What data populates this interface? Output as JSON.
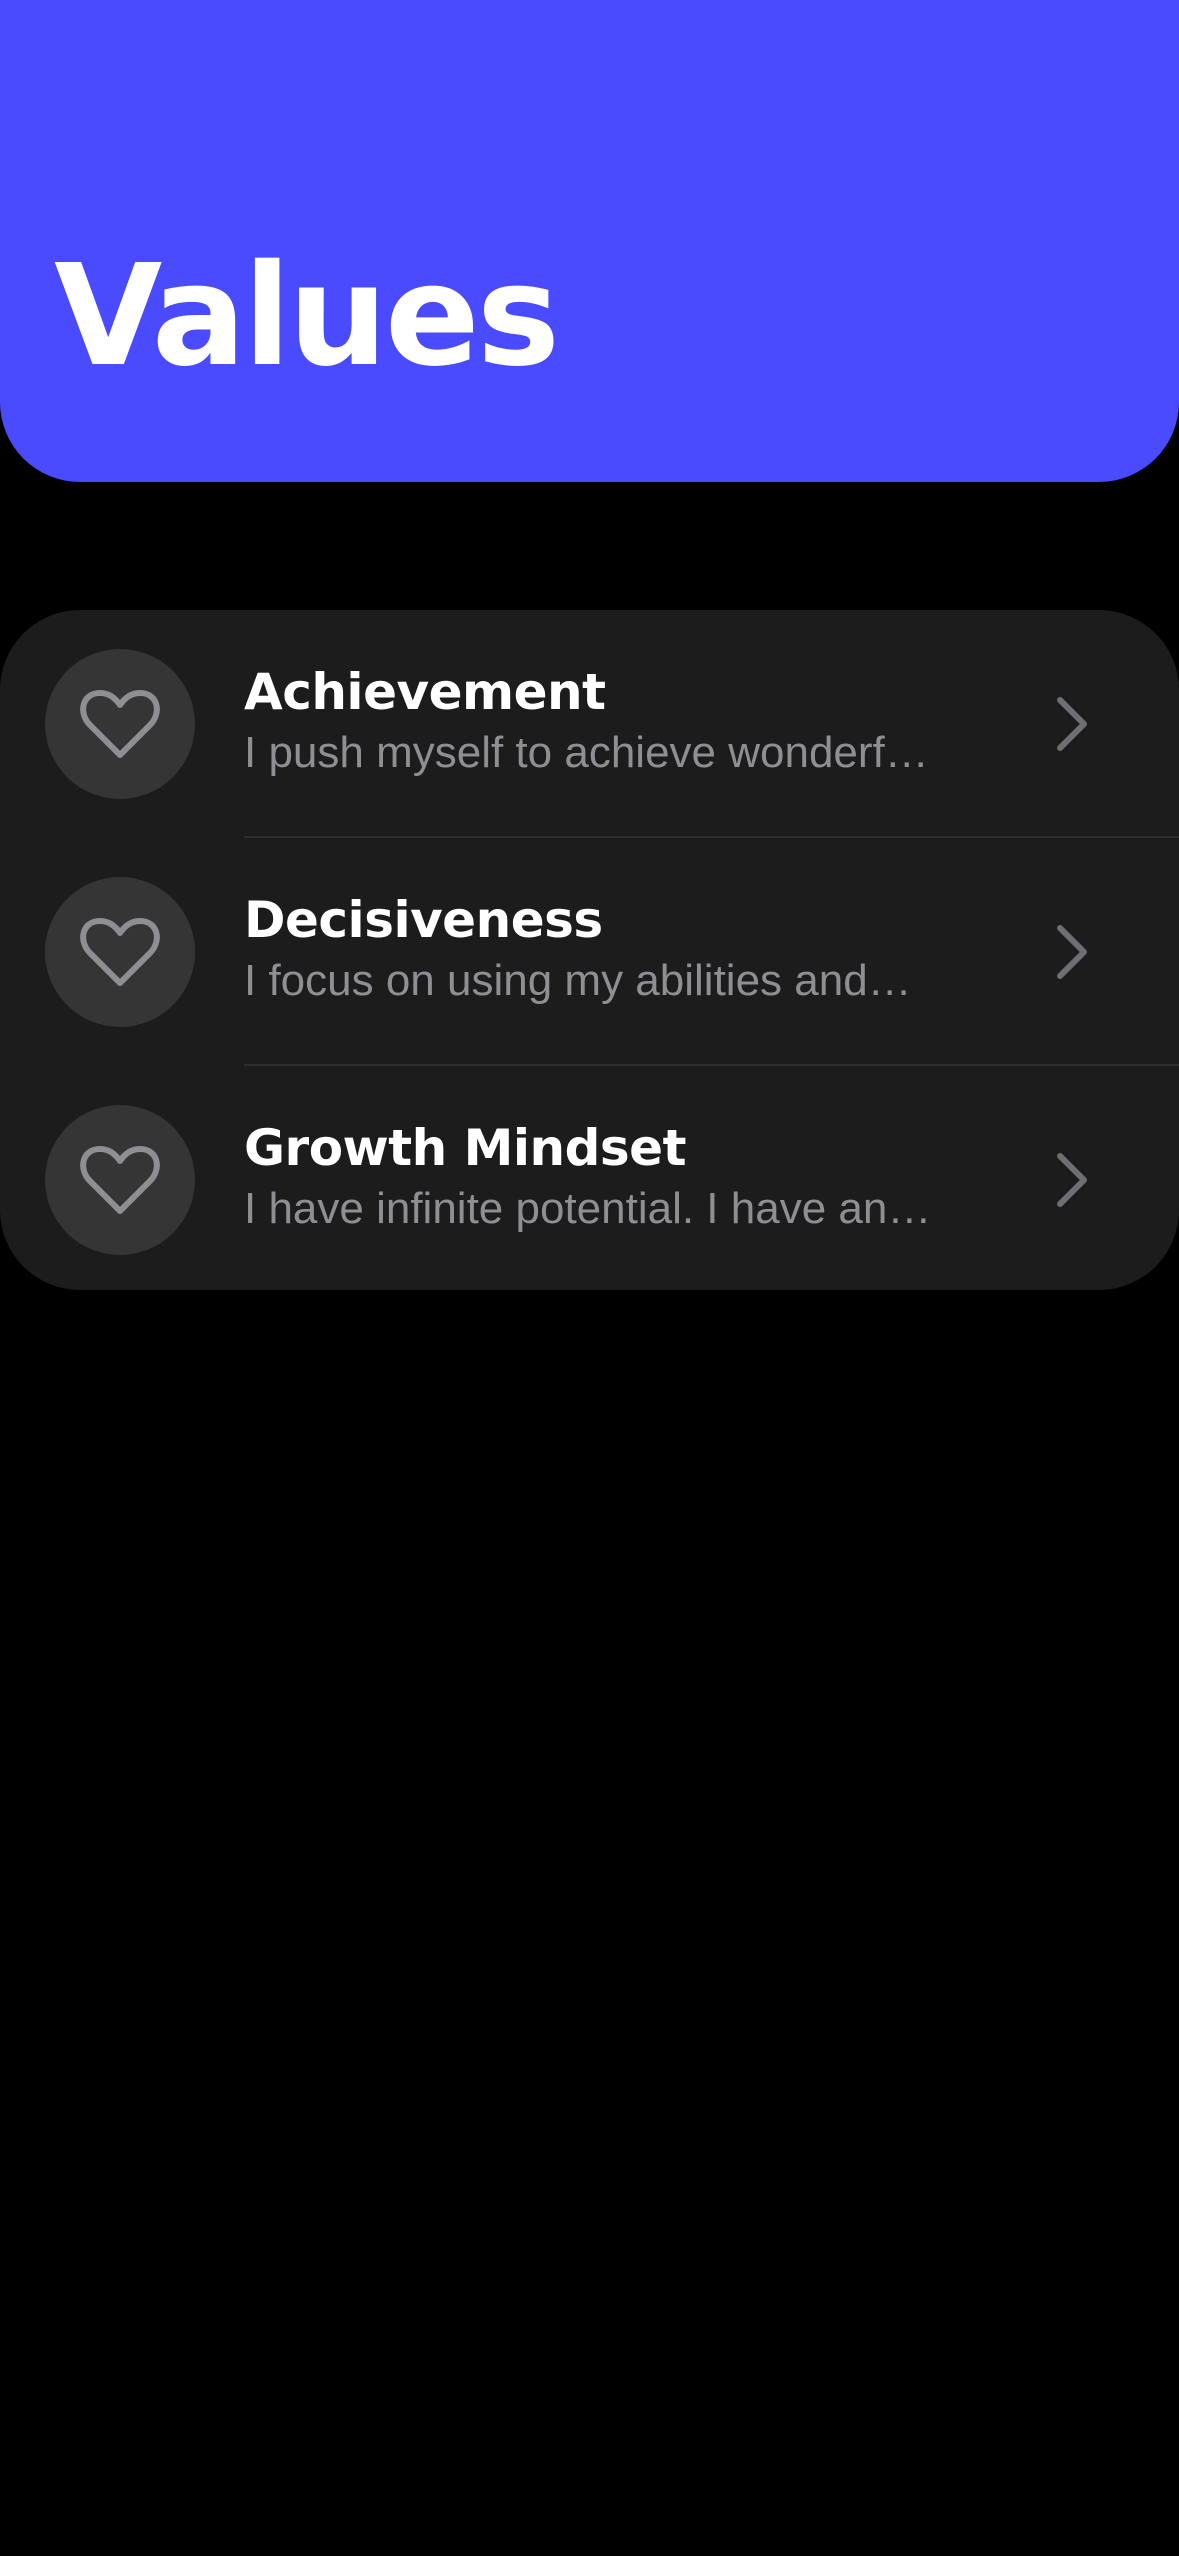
{
  "header": {
    "title": "Values",
    "background_color": "#4a4aff"
  },
  "values": [
    {
      "title": "Achievement",
      "description": "I push myself to achieve wonderf…",
      "icon": "heart-icon"
    },
    {
      "title": "Decisiveness",
      "description": "I focus on using my abilities and…",
      "icon": "heart-icon"
    },
    {
      "title": "Growth Mindset",
      "description": "I have infinite potential. I have an…",
      "icon": "heart-icon"
    }
  ],
  "colors": {
    "background": "#000000",
    "card": "#1c1c1c",
    "icon_circle": "#353535",
    "secondary_text": "#8e8e93"
  }
}
